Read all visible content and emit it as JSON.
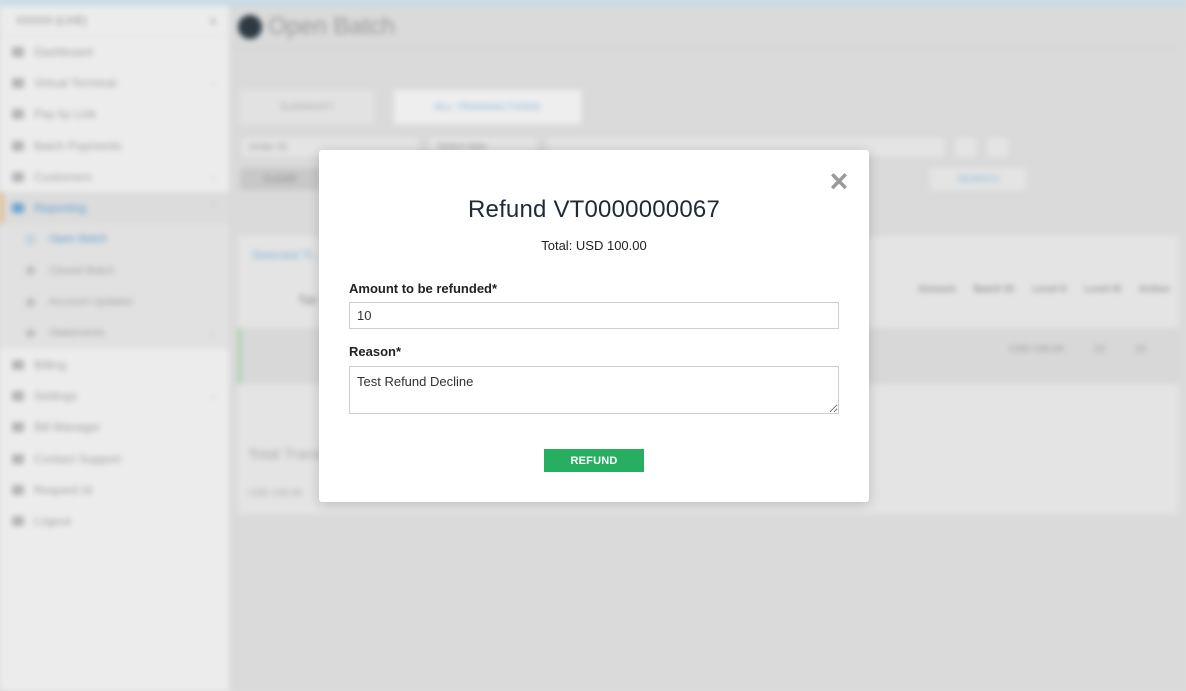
{
  "app": {
    "page_title": "Open Batch",
    "sidebar": {
      "account": "XXXXX (LIVE)",
      "items": [
        {
          "label": "Dashboard"
        },
        {
          "label": "Virtual Terminal"
        },
        {
          "label": "Pay by Link"
        },
        {
          "label": "Batch Payments"
        },
        {
          "label": "Customers"
        },
        {
          "label": "Reporting"
        },
        {
          "label": "Open Batch"
        },
        {
          "label": "Closed Batch"
        },
        {
          "label": "Account Updates"
        },
        {
          "label": "Statements"
        },
        {
          "label": "Billing"
        },
        {
          "label": "Settings"
        },
        {
          "label": "Bill Manager"
        },
        {
          "label": "Contact Support"
        },
        {
          "label": "Request Id"
        },
        {
          "label": "Logout"
        }
      ]
    },
    "tabs": [
      "SUMMARY",
      "ALL TRANSACTIONS"
    ],
    "filters": {
      "order": "Order ID",
      "date": "Select date",
      "clear": "CLEAR",
      "search": "SEARCH"
    },
    "panel": {
      "selected": "Selected Tr...",
      "col_type": "Typ",
      "columns": [
        "Amount",
        "Batch ID",
        "Level II",
        "Level III",
        "Action"
      ],
      "row_values": [
        "USD 100.00",
        "23",
        "23"
      ],
      "total_label": "Total Trans...",
      "total_value": "USD 100.00"
    }
  },
  "modal": {
    "title": "Refund VT0000000067",
    "total": "Total: USD 100.00",
    "amount_label": "Amount to be refunded*",
    "amount_value": "10",
    "reason_label": "Reason*",
    "reason_value": "Test Refund Decline",
    "refund_button": "REFUND",
    "close_icon": "×"
  }
}
